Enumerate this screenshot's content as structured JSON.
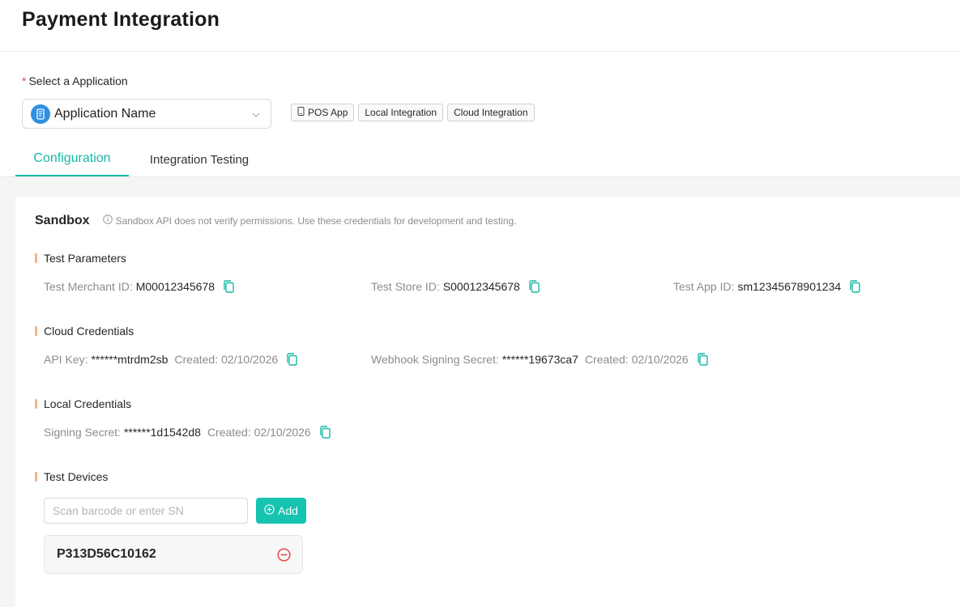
{
  "header": {
    "title": "Payment Integration"
  },
  "app_select": {
    "required_mark": "*",
    "label": "Select a Application",
    "value": "Application Name"
  },
  "tags": [
    {
      "label": "POS App",
      "icon": "phone-icon"
    },
    {
      "label": "Local Integration"
    },
    {
      "label": "Cloud Integration"
    }
  ],
  "tabs": [
    {
      "label": "Configuration",
      "active": true
    },
    {
      "label": "Integration Testing",
      "active": false
    }
  ],
  "sandbox": {
    "title": "Sandbox",
    "note": "Sandbox API does not verify permissions. Use these credentials for development and testing."
  },
  "test_parameters": {
    "title": "Test Parameters",
    "merchant_label": "Test Merchant ID:",
    "merchant_value": "M00012345678",
    "store_label": "Test Store ID:",
    "store_value": "S00012345678",
    "app_label": "Test App ID:",
    "app_value": "sm12345678901234"
  },
  "cloud_credentials": {
    "title": "Cloud Credentials",
    "api_key_label": "API Key:",
    "api_key_value": "******mtrdm2sb",
    "api_key_created_label": "Created:",
    "api_key_created_date": "02/10/2026",
    "webhook_label": "Webhook Signing Secret:",
    "webhook_value": "******19673ca7",
    "webhook_created_label": "Created:",
    "webhook_created_date": "02/10/2026"
  },
  "local_credentials": {
    "title": "Local Credentials",
    "signing_label": "Signing Secret:",
    "signing_value": "******1d1542d8",
    "signing_created_label": "Created:",
    "signing_created_date": "02/10/2026"
  },
  "test_devices": {
    "title": "Test Devices",
    "input_placeholder": "Scan barcode or enter SN",
    "add_label": "Add",
    "devices": [
      {
        "sn": "P313D56C10162"
      }
    ]
  },
  "colors": {
    "accent": "#15b8a6",
    "button": "#15c3b0",
    "section_bar": "#f2b48c",
    "remove": "#e5484d",
    "app_icon": "#2f8fe3"
  }
}
